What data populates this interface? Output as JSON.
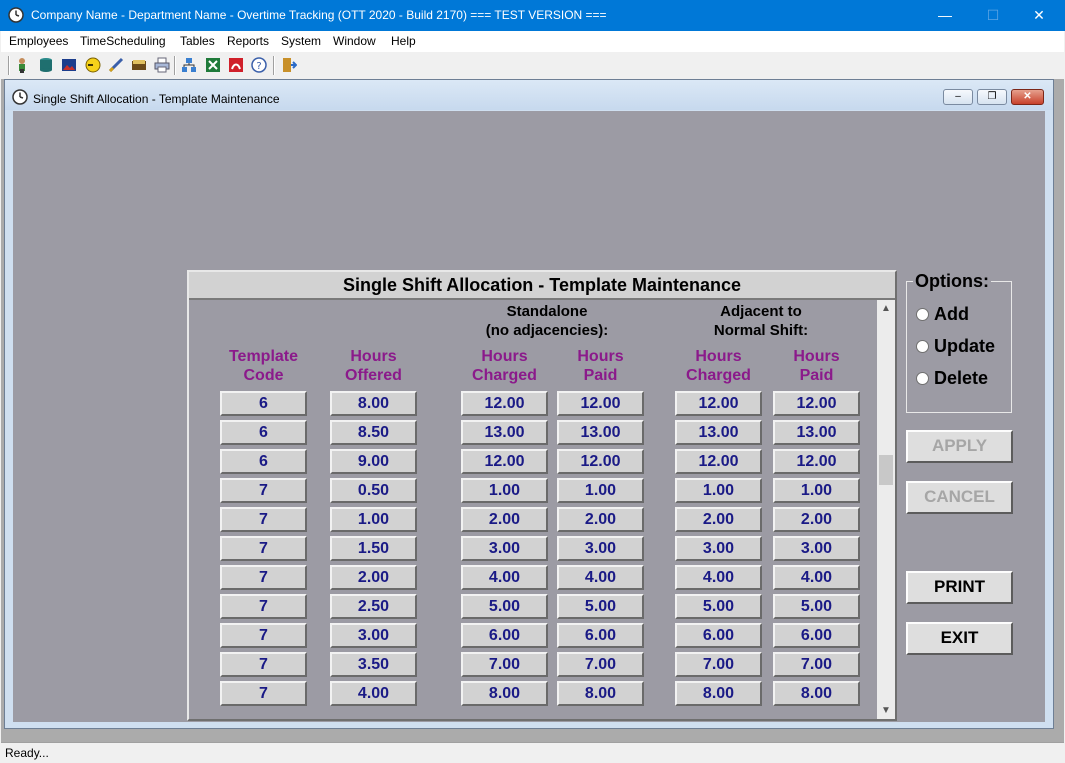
{
  "app": {
    "title": "Company Name - Department Name - Overtime Tracking (OTT 2020 - Build 2170)  === TEST VERSION ===",
    "minimize": "—",
    "maximize": "☐",
    "close": "✕"
  },
  "menu": [
    "Employees",
    "TimeScheduling",
    "Tables",
    "Reports",
    "System",
    "Window",
    "Help"
  ],
  "toolbar": {
    "icons": [
      "employee-icon",
      "database-icon",
      "image-icon",
      "clock-icon",
      "pen-icon",
      "book-icon",
      "printer-icon",
      "network-icon",
      "excel-icon",
      "acrobat-icon",
      "help-icon",
      "exit-door-icon"
    ]
  },
  "child": {
    "title": "Single Shift Allocation - Template Maintenance"
  },
  "panel": {
    "header": "Single Shift Allocation - Template Maintenance",
    "group_standalone": [
      "Standalone",
      "(no adjacencies):"
    ],
    "group_adjacent": [
      "Adjacent to",
      "Normal Shift:"
    ],
    "columns": [
      [
        "Template",
        "Code"
      ],
      [
        "Hours",
        "Offered"
      ],
      [
        "Hours",
        "Charged"
      ],
      [
        "Hours",
        "Paid"
      ],
      [
        "Hours",
        "Charged"
      ],
      [
        "Hours",
        "Paid"
      ]
    ],
    "rows": [
      [
        "6",
        "8.00",
        "12.00",
        "12.00",
        "12.00",
        "12.00"
      ],
      [
        "6",
        "8.50",
        "13.00",
        "13.00",
        "13.00",
        "13.00"
      ],
      [
        "6",
        "9.00",
        "12.00",
        "12.00",
        "12.00",
        "12.00"
      ],
      [
        "7",
        "0.50",
        "1.00",
        "1.00",
        "1.00",
        "1.00"
      ],
      [
        "7",
        "1.00",
        "2.00",
        "2.00",
        "2.00",
        "2.00"
      ],
      [
        "7",
        "1.50",
        "3.00",
        "3.00",
        "3.00",
        "3.00"
      ],
      [
        "7",
        "2.00",
        "4.00",
        "4.00",
        "4.00",
        "4.00"
      ],
      [
        "7",
        "2.50",
        "5.00",
        "5.00",
        "5.00",
        "5.00"
      ],
      [
        "7",
        "3.00",
        "6.00",
        "6.00",
        "6.00",
        "6.00"
      ],
      [
        "7",
        "3.50",
        "7.00",
        "7.00",
        "7.00",
        "7.00"
      ],
      [
        "7",
        "4.00",
        "8.00",
        "8.00",
        "8.00",
        "8.00"
      ]
    ],
    "scroll_up": "▲",
    "scroll_down": "▼"
  },
  "options": {
    "title": "Options:",
    "items": [
      "Add",
      "Update",
      "Delete"
    ]
  },
  "buttons": {
    "apply": "APPLY",
    "cancel": "CANCEL",
    "print": "PRINT",
    "exit": "EXIT"
  },
  "status": {
    "text": "Ready..."
  }
}
